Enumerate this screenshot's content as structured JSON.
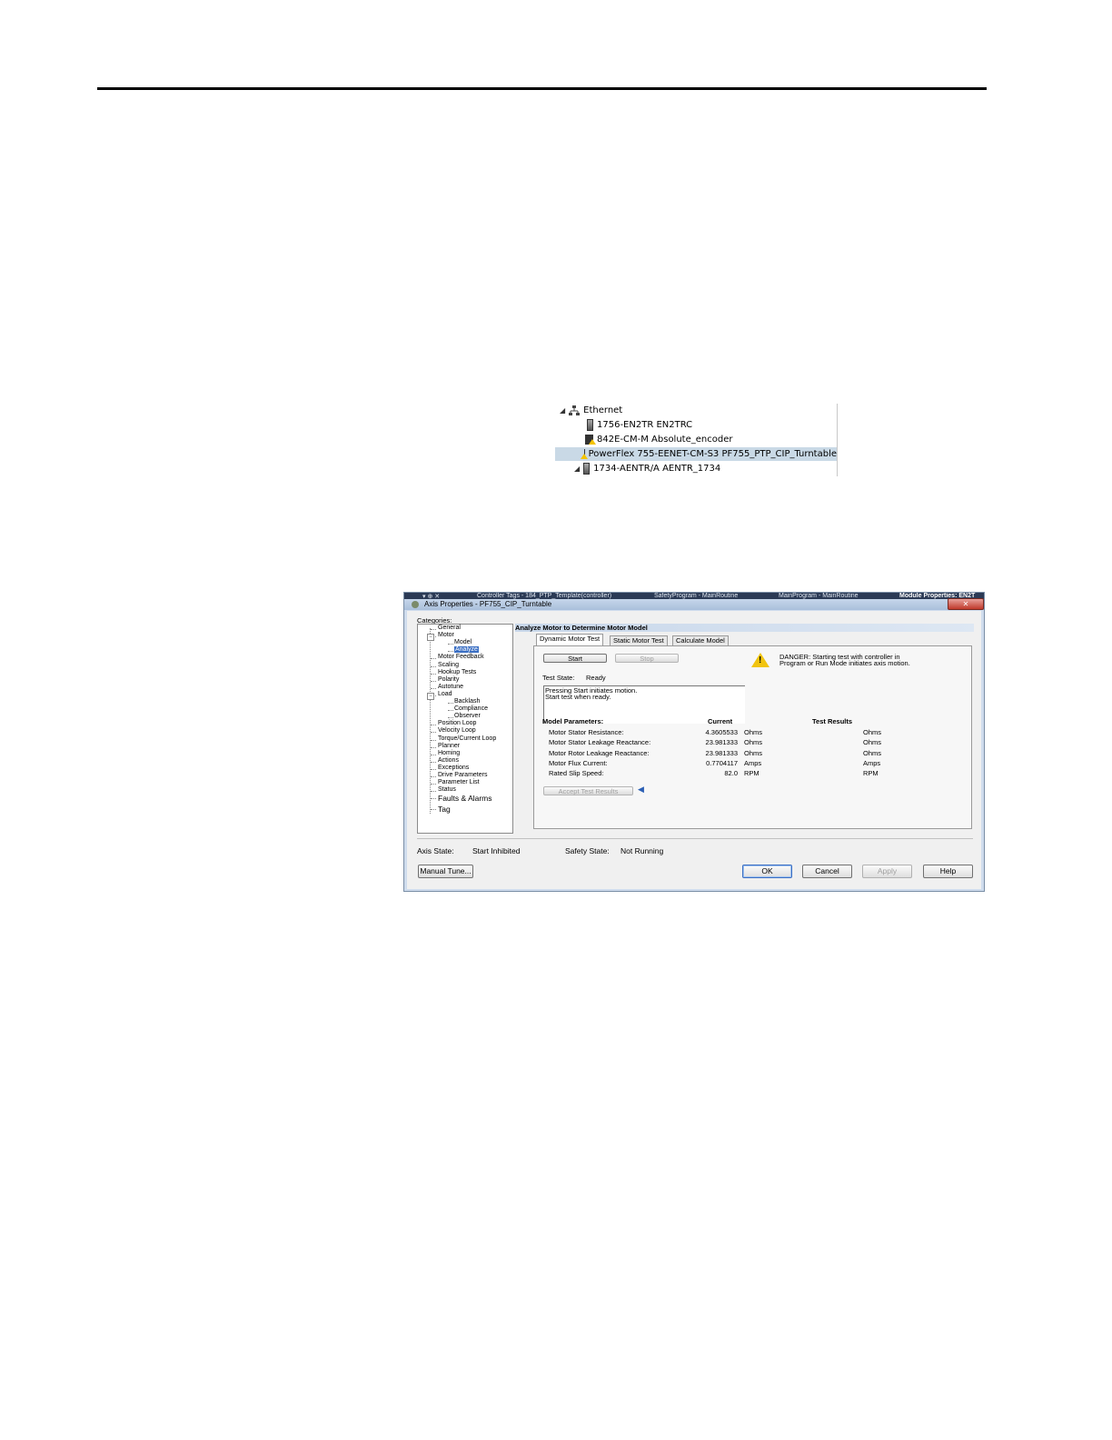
{
  "tree": {
    "root_label": "Ethernet",
    "items": [
      {
        "label": "1756-EN2TR EN2TRC",
        "icon": "module-icon"
      },
      {
        "label": "842E-CM-M Absolute_encoder",
        "icon": "warning-module-icon"
      },
      {
        "label": "PowerFlex 755-EENET-CM-S3 PF755_PTP_CIP_Turntable",
        "icon": "warning-drive-icon",
        "selected": true
      },
      {
        "label": "1734-AENTR/A AENTR_1734",
        "icon": "module-icon"
      }
    ]
  },
  "dialog": {
    "doc_tabs": [
      "Controller Tags - 184_PTP_Template(controller)",
      "SafetyProgram - MainRoutine",
      "MainProgram - MainRoutine",
      "Module Properties: EN2T"
    ],
    "title": "Axis Properties - PF755_CIP_Turntable",
    "close_label": "✕",
    "categories_label": "Categories:",
    "categories": [
      {
        "label": "General",
        "level": 0
      },
      {
        "label": "Motor",
        "level": 0,
        "expander": true
      },
      {
        "label": "Model",
        "level": 1
      },
      {
        "label": "Analyze",
        "level": 1,
        "selected": true
      },
      {
        "label": "Motor Feedback",
        "level": 0
      },
      {
        "label": "Scaling",
        "level": 0
      },
      {
        "label": "Hookup Tests",
        "level": 0
      },
      {
        "label": "Polarity",
        "level": 0
      },
      {
        "label": "Autotune",
        "level": 0
      },
      {
        "label": "Load",
        "level": 0,
        "expander": true
      },
      {
        "label": "Backlash",
        "level": 1
      },
      {
        "label": "Compliance",
        "level": 1
      },
      {
        "label": "Observer",
        "level": 1
      },
      {
        "label": "Position Loop",
        "level": 0
      },
      {
        "label": "Velocity Loop",
        "level": 0
      },
      {
        "label": "Torque/Current Loop",
        "level": 0
      },
      {
        "label": "Planner",
        "level": 0
      },
      {
        "label": "Homing",
        "level": 0
      },
      {
        "label": "Actions",
        "level": 0
      },
      {
        "label": "Exceptions",
        "level": 0
      },
      {
        "label": "Drive Parameters",
        "level": 0
      },
      {
        "label": "Parameter List",
        "level": 0
      },
      {
        "label": "Status",
        "level": 0
      },
      {
        "label": "Faults & Alarms",
        "level": 0,
        "large": true
      },
      {
        "label": "Tag",
        "level": 0,
        "large": true
      }
    ],
    "section_title": "Analyze Motor to Determine Motor Model",
    "tabs": [
      "Dynamic Motor Test",
      "Static Motor Test",
      "Calculate Model"
    ],
    "active_tab": 0,
    "start_label": "Start",
    "stop_label": "Stop",
    "danger_text": [
      "DANGER: Starting test with controller in",
      "Program or Run Mode initiates axis motion."
    ],
    "test_state_label": "Test State:",
    "test_state_value": "Ready",
    "message_lines": [
      "Pressing Start initiates motion.",
      "Start test when ready."
    ],
    "params_header": "Model Parameters:",
    "current_header": "Current",
    "results_header": "Test Results",
    "params": [
      {
        "name": "Motor Stator Resistance:",
        "current": "4.3605533",
        "unit": "Ohms",
        "result_unit": "Ohms"
      },
      {
        "name": "Motor Stator Leakage Reactance:",
        "current": "23.981333",
        "unit": "Ohms",
        "result_unit": "Ohms"
      },
      {
        "name": "Motor Rotor Leakage Reactance:",
        "current": "23.981333",
        "unit": "Ohms",
        "result_unit": "Ohms"
      },
      {
        "name": "Motor Flux Current:",
        "current": "0.7704117",
        "unit": "Amps",
        "result_unit": "Amps"
      },
      {
        "name": "Rated Slip Speed:",
        "current": "82.0",
        "unit": "RPM",
        "result_unit": "RPM"
      }
    ],
    "accept_label": "Accept Test Results",
    "axis_state_label": "Axis State:",
    "axis_state_value": "Start Inhibited",
    "safety_state_label": "Safety State:",
    "safety_state_value": "Not Running",
    "buttons": {
      "manual_tune": "Manual Tune...",
      "ok": "OK",
      "cancel": "Cancel",
      "apply": "Apply",
      "help": "Help"
    }
  }
}
